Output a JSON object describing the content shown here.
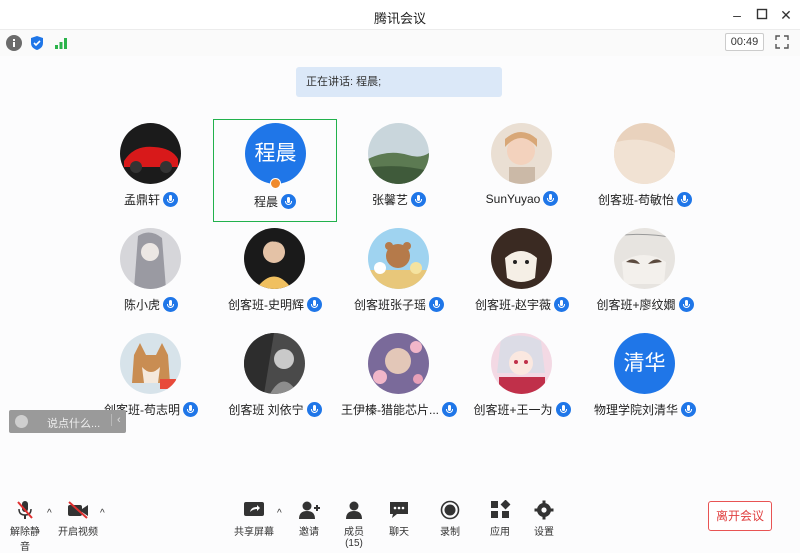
{
  "window": {
    "title": "腾讯会议"
  },
  "status": {
    "timer": "00:49"
  },
  "speaker_bar": {
    "text": "正在讲话: 程晨;"
  },
  "participants": [
    {
      "name": "孟鼎轩",
      "avatar": "photo"
    },
    {
      "name": "程晨",
      "avatar_text": "程晨",
      "active": true,
      "host": true
    },
    {
      "name": "张馨艺",
      "avatar": "photo"
    },
    {
      "name": "SunYuyao",
      "avatar": "photo"
    },
    {
      "name": "创客班-苟敏怡",
      "avatar": "photo"
    },
    {
      "name": "陈小虎",
      "avatar": "photo"
    },
    {
      "name": "创客班-史明辉",
      "avatar": "photo"
    },
    {
      "name": "创客班张子瑶",
      "avatar": "photo"
    },
    {
      "name": "创客班-赵宇薇",
      "avatar": "photo"
    },
    {
      "name": "创客班+廖纹嫺",
      "avatar": "photo"
    },
    {
      "name": "创客班-苟志明",
      "avatar": "photo"
    },
    {
      "name": "创客班 刘依宁",
      "avatar": "photo"
    },
    {
      "name": "王伊榛-猎能芯片...",
      "avatar": "photo"
    },
    {
      "name": "创客班+王一为",
      "avatar": "photo"
    },
    {
      "name": "物理学院刘清华",
      "avatar_text": "清华"
    }
  ],
  "chat": {
    "placeholder": "说点什么..."
  },
  "toolbar": {
    "unmute": "解除静音",
    "video": "开启视频",
    "share": "共享屏幕",
    "invite": "邀请",
    "members": "成员(15)",
    "chat": "聊天",
    "record": "录制",
    "apps": "应用",
    "settings": "设置",
    "leave": "离开会议"
  },
  "colors": {
    "accent": "#1f76e8",
    "active_border": "#22b14c",
    "leave": "#e04040"
  }
}
